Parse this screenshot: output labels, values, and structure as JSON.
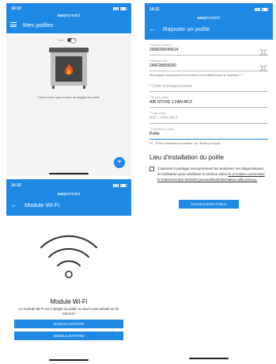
{
  "colors": {
    "primary": "#1e88e5",
    "background": "#ffffff",
    "body_gray": "#f4f4f4"
  },
  "brand": {
    "prefix": "easy",
    "suffix": "connect"
  },
  "screen1": {
    "time": "14:10",
    "title": "Mes poêles",
    "toggle_left": "Mes",
    "toggle_right": "",
    "empty_message": "Vous n'avez pas encore renseigné de poêle",
    "fab_label": "+",
    "menu_icon": "hamburger-menu-icon"
  },
  "screen2": {
    "time": "14:11",
    "title": "Rajouter un poêle",
    "fields": {
      "serial": {
        "label": "* Numéro de série",
        "value": "2008200040014"
      },
      "mac": {
        "label": "* Adresse MAC",
        "value": "246F28826080"
      },
      "registration_code": {
        "placeholder": "* Code d'enregistrement"
      },
      "article_model": {
        "label": "* Modèle article",
        "value": "AIR STOVE 1 FAN MCZ"
      },
      "article_code": {
        "label": "* Code article",
        "value": "AIR 1 FAN MCZ"
      },
      "stove_description": {
        "label": "* Descriptif du poêle",
        "value": "Poêle"
      }
    },
    "mac_hint": "Renseigner uniquement les numéros et les lettres sans le caractère \":\"",
    "description_hint": "Ex. \"Poêle résidence secondaire\" ou \"Poêle principal\"",
    "section_title": "Lieu d'installation du poêle",
    "consent_before": "J'autorise à partager anonymement les analyses, les diagnostiques, et l'utilisation pour améliorer le service selon ",
    "consent_link": "la circulaire concernant le traitement des données personelles/informativa sulla privacy.",
    "save_button": "SAUVEGARDE POÊLE"
  },
  "screen3": {
    "time": "14:10",
    "title": "Module Wi-Fi",
    "heading": "Module Wi-Fi",
    "question": "Le module Wi-Fi est-il intégré au poêle ou avez-vous acheté un kit externe?",
    "button_integrated": "MODULE INTÉGRÉ",
    "button_external": "MODULE EXTERNE"
  }
}
